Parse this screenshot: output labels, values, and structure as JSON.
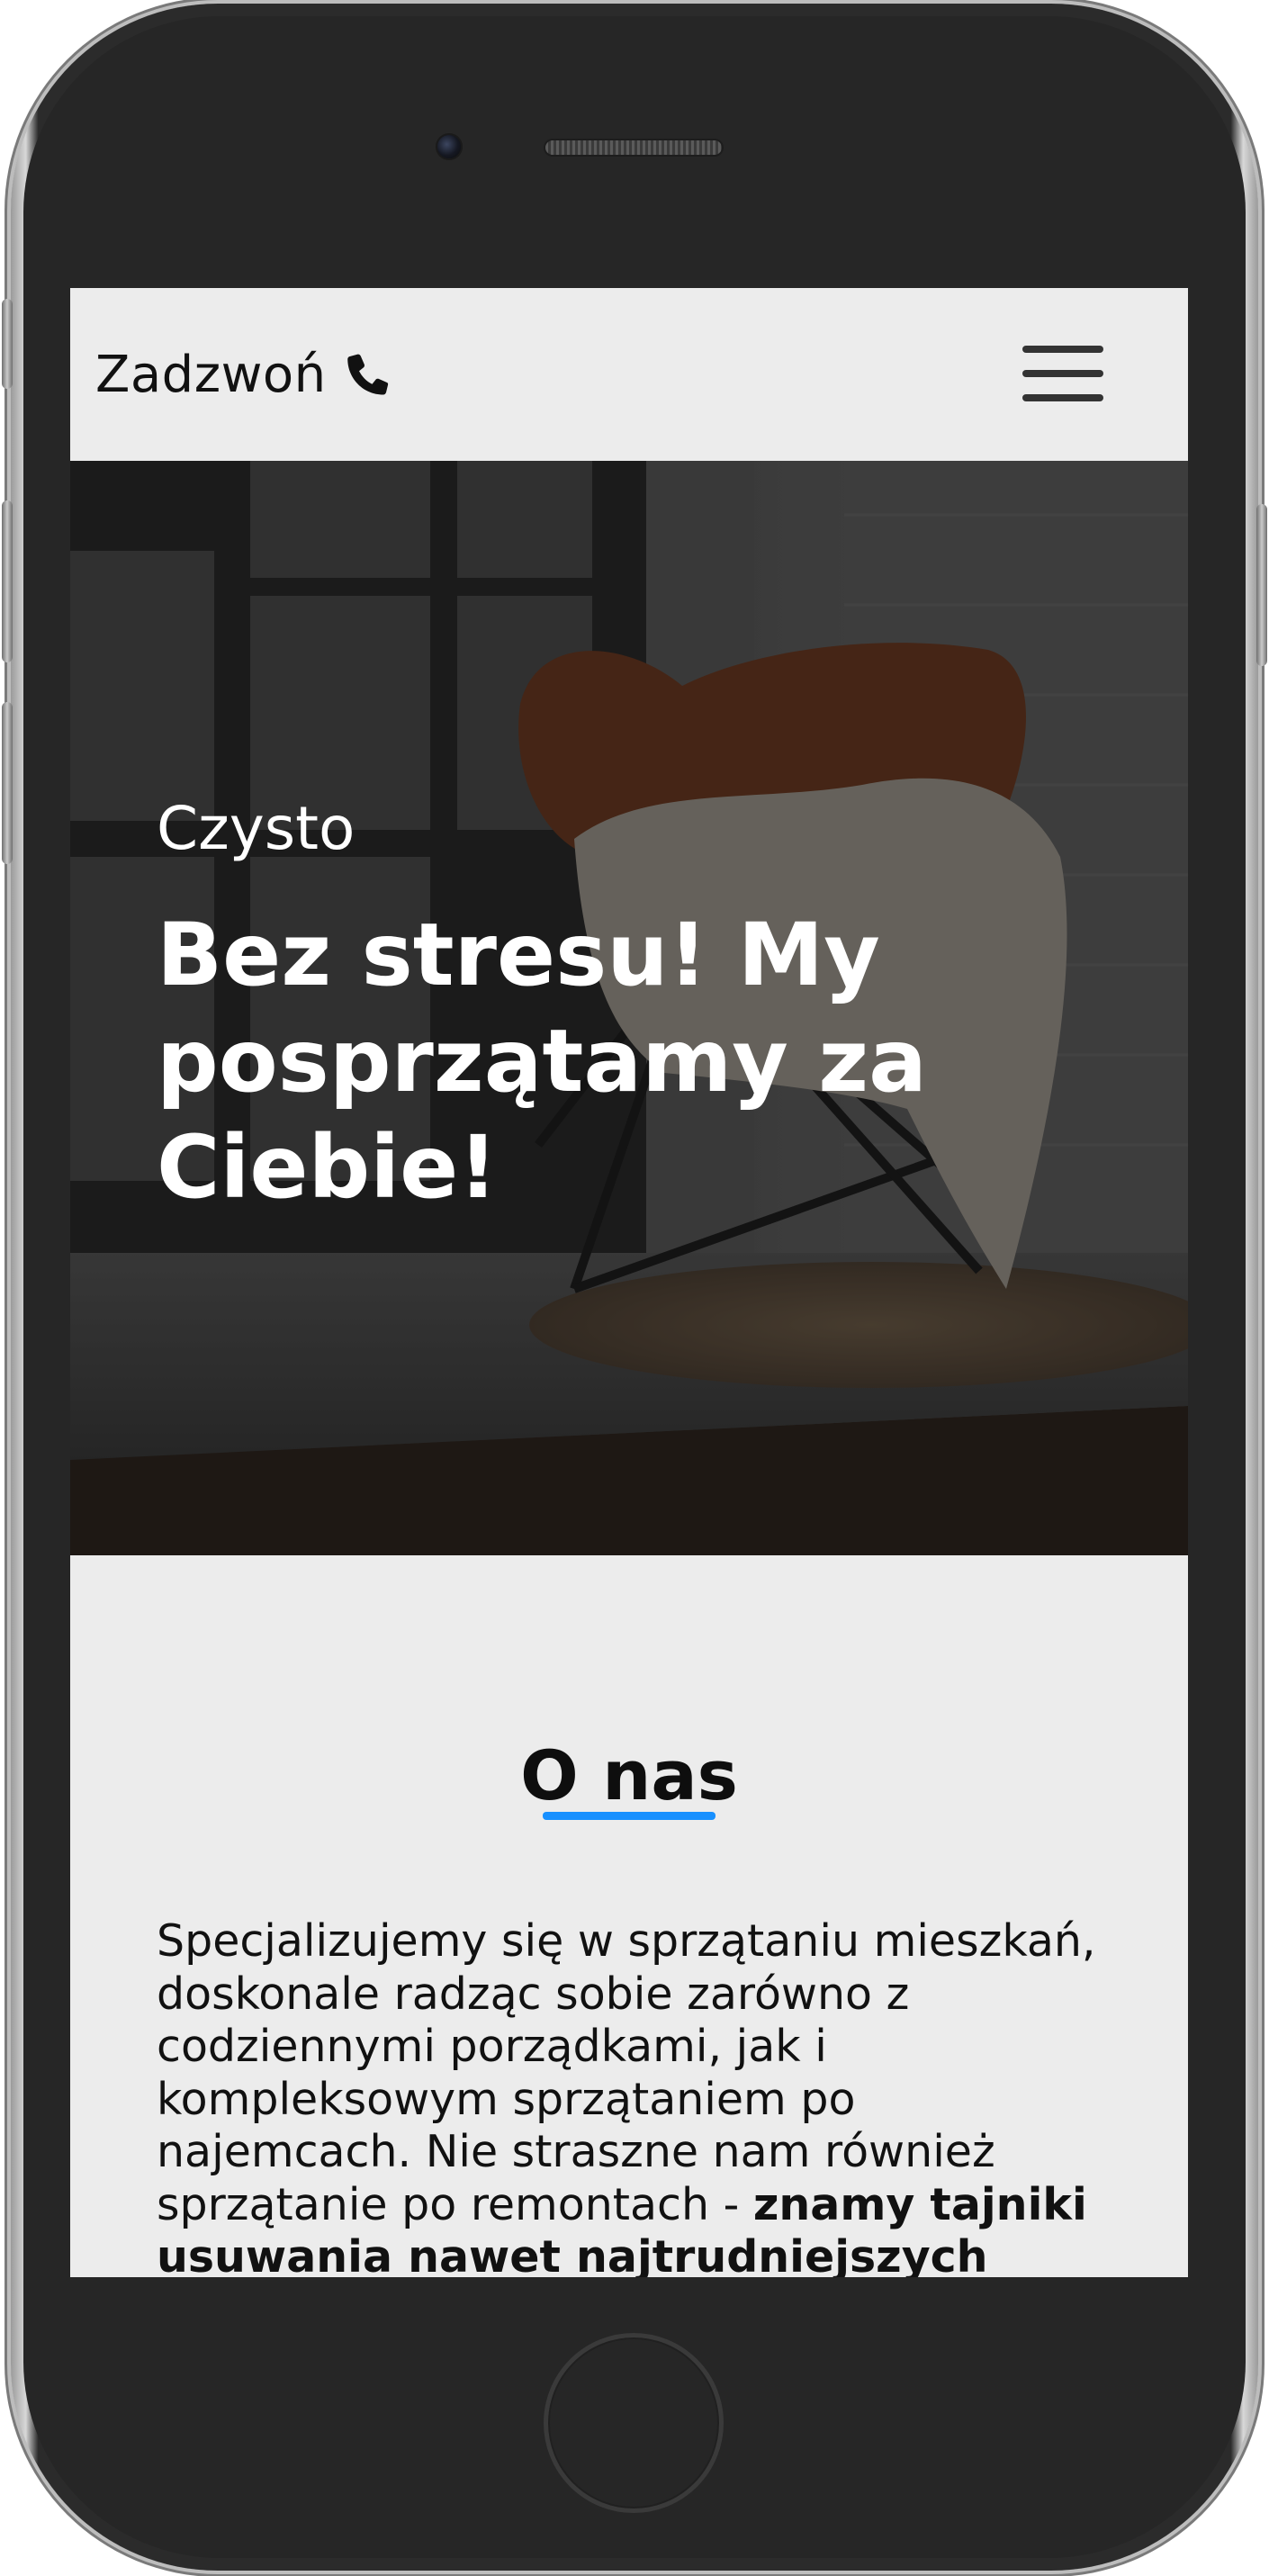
{
  "navbar": {
    "call_label": "Zadzwoń",
    "call_icon": "phone-icon",
    "menu_icon": "hamburger-menu-icon"
  },
  "hero": {
    "kicker": "Czysto",
    "title": "Bez stresu! My posprzątamy za Ciebie!"
  },
  "about": {
    "title": "O nas",
    "text": "Specjalizujemy się w sprzątaniu mieszkań, doskonale radząc sobie zarówno z codziennymi porządkami, jak i kompleksowym sprzątaniem po najemcach. Nie straszne nam również sprzątanie po remontach - ",
    "text_bold": "znamy tajniki usuwania nawet najtrudniejszych",
    "accent_color": "#1890ff"
  },
  "device": {
    "icons": [
      "camera-icon",
      "speaker-icon",
      "home-button-icon"
    ]
  }
}
